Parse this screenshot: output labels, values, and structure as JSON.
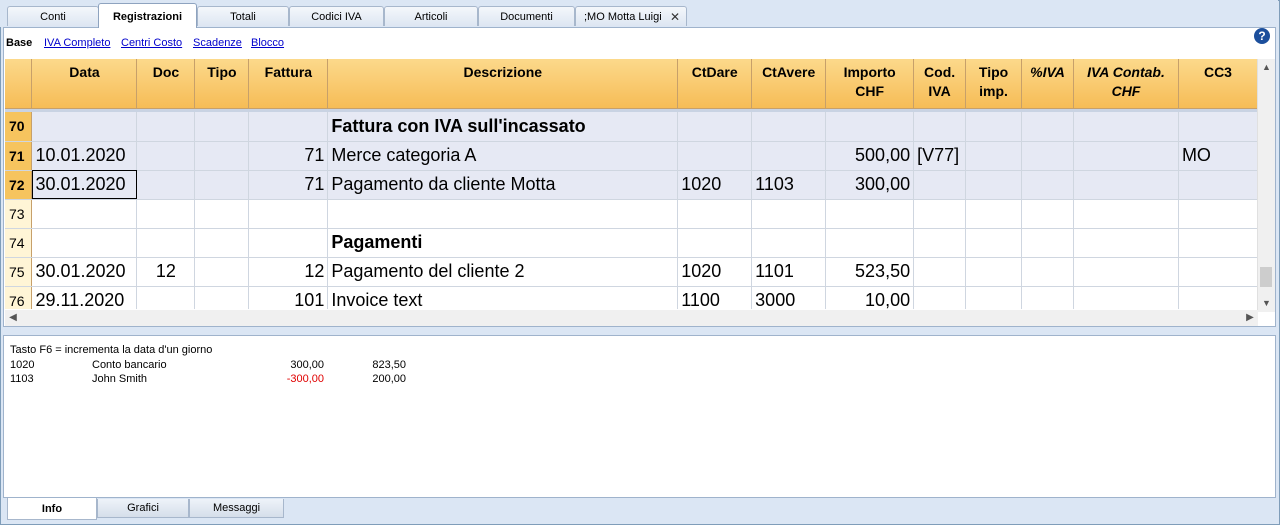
{
  "tabs": [
    "Conti",
    "Registrazioni",
    "Totali",
    "Codici IVA",
    "Articoli",
    "Documenti",
    ";MO Motta Luigi"
  ],
  "active_tab": "Registrazioni",
  "views": {
    "current": "Base",
    "links": [
      "IVA Completo",
      "Centri Costo",
      "Scadenze",
      "Blocco"
    ]
  },
  "help_symbol": "?",
  "columns": [
    {
      "label": "Data",
      "line2": ""
    },
    {
      "label": "Doc",
      "line2": ""
    },
    {
      "label": "Tipo",
      "line2": ""
    },
    {
      "label": "Fattura",
      "line2": ""
    },
    {
      "label": "Descrizione",
      "line2": ""
    },
    {
      "label": "CtDare",
      "line2": ""
    },
    {
      "label": "CtAvere",
      "line2": ""
    },
    {
      "label": "Importo",
      "line2": "CHF"
    },
    {
      "label": "Cod.",
      "line2": "IVA"
    },
    {
      "label": "Tipo",
      "line2": "imp."
    },
    {
      "label": "%IVA",
      "line2": ""
    },
    {
      "label": "IVA Contab.",
      "line2": "CHF"
    },
    {
      "label": "CC3",
      "line2": ""
    }
  ],
  "rows": [
    {
      "n": "70",
      "data": "",
      "doc": "",
      "tipo": "",
      "fattura": "",
      "descrizione": "Fattura con IVA sull'incassato",
      "ctdare": "",
      "ctavere": "",
      "importo": "",
      "codiva": "",
      "tipoimp": "",
      "piva": "",
      "ivacontab": "",
      "cc3": ""
    },
    {
      "n": "71",
      "data": "10.01.2020",
      "doc": "",
      "tipo": "",
      "fattura": "71",
      "descrizione": "Merce categoria A",
      "ctdare": "",
      "ctavere": "",
      "importo": "500,00",
      "codiva": "[V77]",
      "tipoimp": "",
      "piva": "",
      "ivacontab": "",
      "cc3": "MO"
    },
    {
      "n": "72",
      "data": "30.01.2020",
      "doc": "",
      "tipo": "",
      "fattura": "71",
      "descrizione": "Pagamento da cliente Motta",
      "ctdare": "1020",
      "ctavere": "1103",
      "importo": "300,00",
      "codiva": "",
      "tipoimp": "",
      "piva": "",
      "ivacontab": "",
      "cc3": ""
    },
    {
      "n": "73",
      "data": "",
      "doc": "",
      "tipo": "",
      "fattura": "",
      "descrizione": "",
      "ctdare": "",
      "ctavere": "",
      "importo": "",
      "codiva": "",
      "tipoimp": "",
      "piva": "",
      "ivacontab": "",
      "cc3": ""
    },
    {
      "n": "74",
      "data": "",
      "doc": "",
      "tipo": "",
      "fattura": "",
      "descrizione": "Pagamenti",
      "ctdare": "",
      "ctavere": "",
      "importo": "",
      "codiva": "",
      "tipoimp": "",
      "piva": "",
      "ivacontab": "",
      "cc3": ""
    },
    {
      "n": "75",
      "data": "30.01.2020",
      "doc": "12",
      "tipo": "",
      "fattura": "12",
      "descrizione": "Pagamento del cliente 2",
      "ctdare": "1020",
      "ctavere": "1101",
      "importo": "523,50",
      "codiva": "",
      "tipoimp": "",
      "piva": "",
      "ivacontab": "",
      "cc3": ""
    },
    {
      "n": "76",
      "data": "29.11.2020",
      "doc": "",
      "tipo": "",
      "fattura": "101",
      "descrizione": "Invoice text",
      "ctdare": "1100",
      "ctavere": "3000",
      "importo": "10,00",
      "codiva": "",
      "tipoimp": "",
      "piva": "",
      "ivacontab": "",
      "cc3": ""
    }
  ],
  "info": {
    "hint": "Tasto F6 = incrementa la data d'un giorno",
    "lines": [
      {
        "account": "1020",
        "name": "Conto bancario",
        "amount": "300,00",
        "balance": "823,50",
        "negative": false
      },
      {
        "account": "1103",
        "name": "John Smith",
        "amount": "-300,00",
        "balance": "200,00",
        "negative": true
      }
    ]
  },
  "bottom_tabs": [
    "Info",
    "Grafici",
    "Messaggi"
  ],
  "active_bottom_tab": "Info"
}
